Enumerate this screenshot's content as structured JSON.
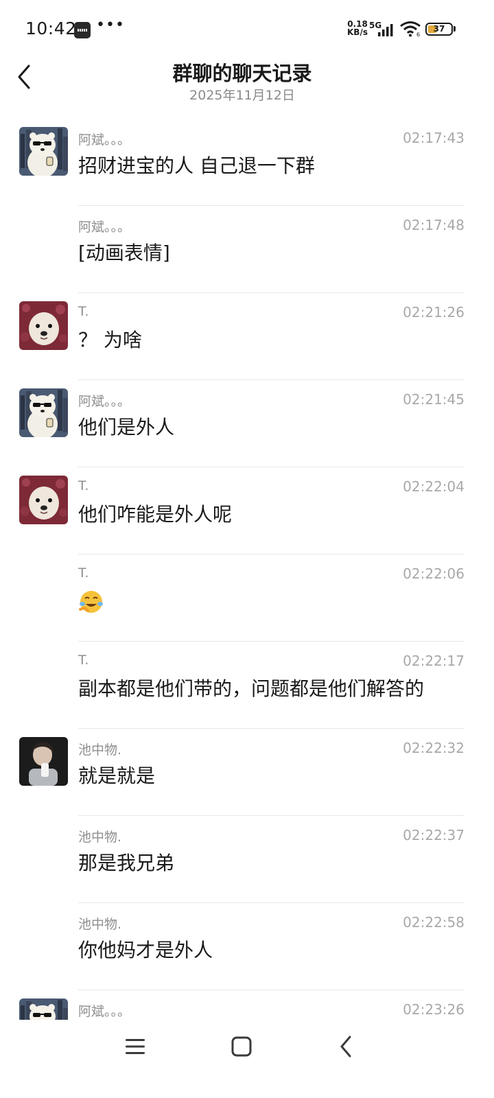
{
  "status_bar": {
    "time": "10:42",
    "more_icon": "•••",
    "net_speed_value": "0.18",
    "net_speed_unit": "KB/s",
    "network_type": "5G",
    "battery_level": "37"
  },
  "header": {
    "title": "群聊的聊天记录",
    "date": "2025年11月12日",
    "back_icon": "chevron-left-icon"
  },
  "messages": [
    {
      "sender": "阿斌。。。",
      "time": "02:17:43",
      "text": "招财进宝的人  自己退一下群",
      "avatar": "bear"
    },
    {
      "sender": "阿斌。。。",
      "time": "02:17:48",
      "text": "[动画表情]",
      "avatar": ""
    },
    {
      "sender": "T.",
      "time": "02:21:26",
      "text": "？ 为啥",
      "avatar": "dog"
    },
    {
      "sender": "阿斌。。。",
      "time": "02:21:45",
      "text": "他们是外人",
      "avatar": "bear"
    },
    {
      "sender": "T.",
      "time": "02:22:04",
      "text": "他们咋能是外人呢",
      "avatar": "dog"
    },
    {
      "sender": "T.",
      "time": "02:22:06",
      "text": "",
      "emoji": "laughing-crying-emoji",
      "avatar": ""
    },
    {
      "sender": "T.",
      "time": "02:22:17",
      "text": "副本都是他们带的，问题都是他们解答的",
      "avatar": ""
    },
    {
      "sender": "池中物.",
      "time": "02:22:32",
      "text": "就是就是",
      "avatar": "man"
    },
    {
      "sender": "池中物.",
      "time": "02:22:37",
      "text": "那是我兄弟",
      "avatar": ""
    },
    {
      "sender": "池中物.",
      "time": "02:22:58",
      "text": "你他妈才是外人",
      "avatar": ""
    },
    {
      "sender": "阿斌。。。",
      "time": "02:23:26",
      "text": "",
      "avatar": "bear"
    }
  ],
  "nav_bar": {
    "menu_icon": "menu-icon",
    "home_icon": "home-square-icon",
    "back_icon": "back-triangle-icon"
  },
  "colors": {
    "battery": "#e2a93c",
    "meta_text": "#a8a8a8",
    "divider": "#e8e8e8"
  }
}
